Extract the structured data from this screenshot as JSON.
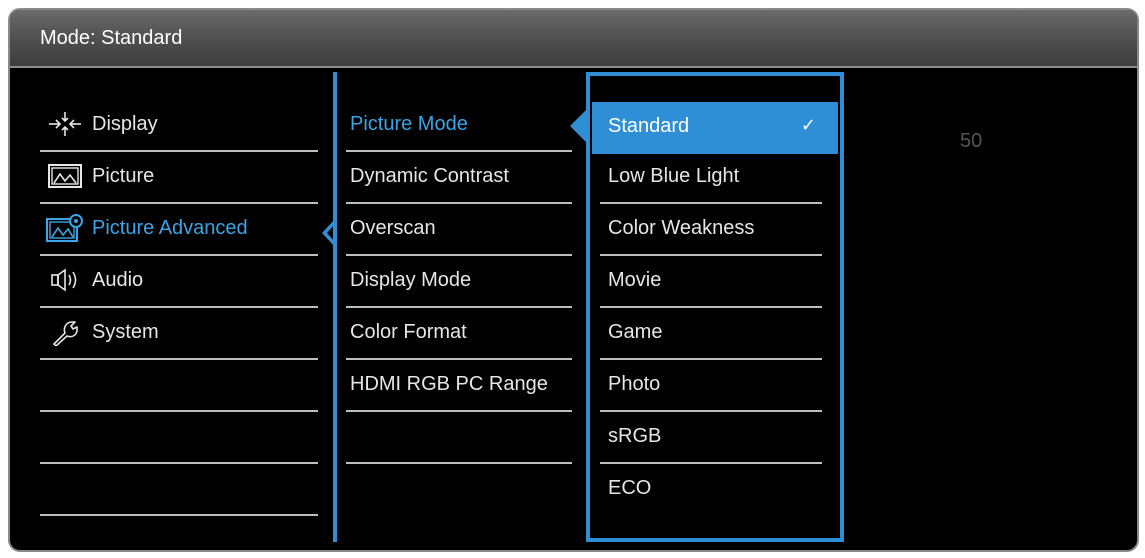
{
  "header": {
    "title": "Mode: Standard"
  },
  "menu": [
    {
      "label": "Display",
      "icon": "display-arrows-icon",
      "active": false
    },
    {
      "label": "Picture",
      "icon": "picture-mountain-icon",
      "active": false
    },
    {
      "label": "Picture Advanced",
      "icon": "picture-advanced-icon",
      "active": true
    },
    {
      "label": "Audio",
      "icon": "speaker-icon",
      "active": false
    },
    {
      "label": "System",
      "icon": "wrench-icon",
      "active": false
    }
  ],
  "submenu": [
    {
      "label": "Picture Mode",
      "active": true
    },
    {
      "label": "Dynamic Contrast",
      "active": false
    },
    {
      "label": "Overscan",
      "active": false
    },
    {
      "label": "Display Mode",
      "active": false
    },
    {
      "label": "Color Format",
      "active": false
    },
    {
      "label": "HDMI RGB PC Range",
      "active": false
    }
  ],
  "options": [
    {
      "label": "Standard",
      "selected": true,
      "check": "✓"
    },
    {
      "label": "Low Blue Light",
      "selected": false
    },
    {
      "label": "Color Weakness",
      "selected": false
    },
    {
      "label": "Movie",
      "selected": false
    },
    {
      "label": "Game",
      "selected": false
    },
    {
      "label": "Photo",
      "selected": false
    },
    {
      "label": "sRGB",
      "selected": false
    },
    {
      "label": "ECO",
      "selected": false
    }
  ],
  "value_readout": "50",
  "colors": {
    "accent": "#2f8fd6",
    "active_text": "#3aa4e6",
    "background": "#000000"
  }
}
